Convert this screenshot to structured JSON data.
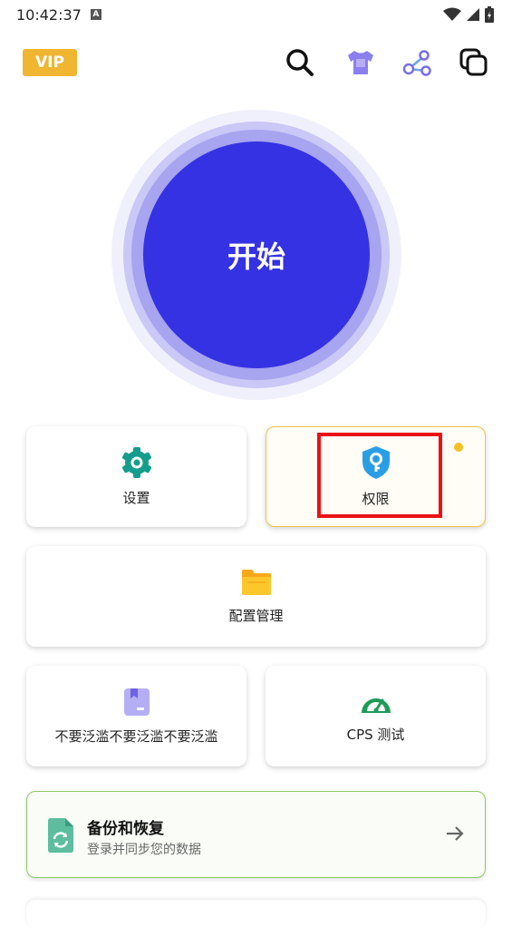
{
  "status_bar": {
    "time": "10:42:37",
    "badge": "A"
  },
  "top_bar": {
    "vip_label": "VIP",
    "icons": [
      "search-icon",
      "tshirt-icon",
      "share-icon",
      "copy-icon"
    ]
  },
  "start_button": {
    "label": "开始",
    "color": "#3532e3"
  },
  "cards": {
    "settings": {
      "label": "设置",
      "icon": "gear-icon"
    },
    "permissions": {
      "label": "权限",
      "icon": "shield-key-icon"
    },
    "config": {
      "label": "配置管理",
      "icon": "folder-icon"
    },
    "flood": {
      "label": "不要泛滥不要泛滥不要泛滥",
      "icon": "bookmark-icon"
    },
    "cps": {
      "label": "CPS 测试",
      "icon": "speedometer-icon"
    }
  },
  "backup": {
    "title": "备份和恢复",
    "subtitle": "登录并同步您的数据",
    "icon": "sync-document-icon"
  },
  "colors": {
    "accent": "#3532e3",
    "vip": "#f0b531",
    "settings_icon": "#159c8c",
    "permission_icon": "#2a9ee5",
    "highlight": "#ea1216",
    "backup_border": "#8cc861"
  }
}
